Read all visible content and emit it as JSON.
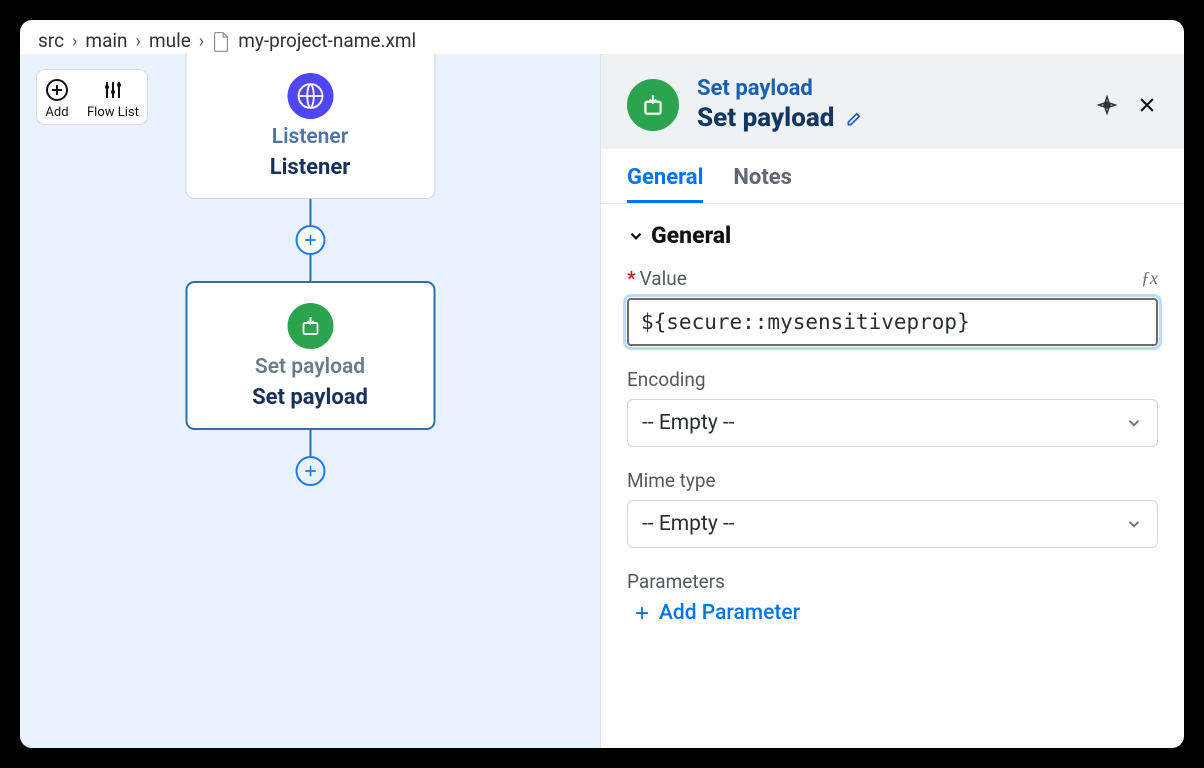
{
  "breadcrumb": {
    "parts": [
      "src",
      "main",
      "mule"
    ],
    "file": "my-project-name.xml"
  },
  "tools": {
    "add": "Add",
    "flowList": "Flow List"
  },
  "flow": {
    "listener": {
      "type": "Listener",
      "name": "Listener"
    },
    "setPayload": {
      "type": "Set payload",
      "name": "Set payload"
    }
  },
  "panel": {
    "type": "Set payload",
    "name": "Set payload",
    "tabs": {
      "general": "General",
      "notes": "Notes"
    },
    "section": "General",
    "fields": {
      "valueLabel": "Value",
      "valueContent": "${secure::mysensitiveprop}",
      "encodingLabel": "Encoding",
      "encodingValue": "-- Empty --",
      "mimeLabel": "Mime type",
      "mimeValue": "-- Empty --",
      "parametersLabel": "Parameters",
      "addParameter": "Add Parameter"
    }
  }
}
